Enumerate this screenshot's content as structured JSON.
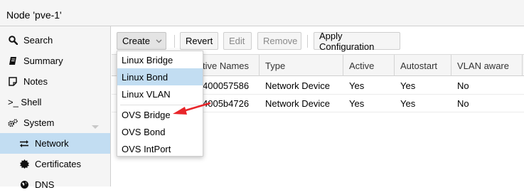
{
  "header": {
    "title": "Node 'pve-1'"
  },
  "sidebar": {
    "items": [
      {
        "label": "Search",
        "icon": "search-icon"
      },
      {
        "label": "Summary",
        "icon": "book-icon"
      },
      {
        "label": "Notes",
        "icon": "notes-icon"
      },
      {
        "label": ">_ Shell",
        "icon": "terminal-icon"
      },
      {
        "label": "System",
        "icon": "gears-icon"
      },
      {
        "label": "Network",
        "icon": "exchange-icon"
      },
      {
        "label": "Certificates",
        "icon": "certificate-icon"
      },
      {
        "label": "DNS",
        "icon": "globe-icon"
      }
    ]
  },
  "toolbar": {
    "create": "Create",
    "revert": "Revert",
    "edit": "Edit",
    "remove": "Remove",
    "apply": "Apply Configuration"
  },
  "grid": {
    "columns": [
      "tive Names",
      "Type",
      "Active",
      "Autostart",
      "VLAN aware"
    ],
    "rows": [
      {
        "names": "400057586",
        "type": "Network Device",
        "active": "Yes",
        "autostart": "Yes",
        "vlan": "No"
      },
      {
        "names": "4005b4726",
        "type": "Network Device",
        "active": "Yes",
        "autostart": "Yes",
        "vlan": "No"
      }
    ]
  },
  "create_menu": {
    "items": [
      "Linux Bridge",
      "Linux Bond",
      "Linux VLAN",
      "OVS Bridge",
      "OVS Bond",
      "OVS IntPort"
    ]
  },
  "colors": {
    "selection": "#c2ddf2",
    "annotation_arrow": "#e8252a"
  }
}
